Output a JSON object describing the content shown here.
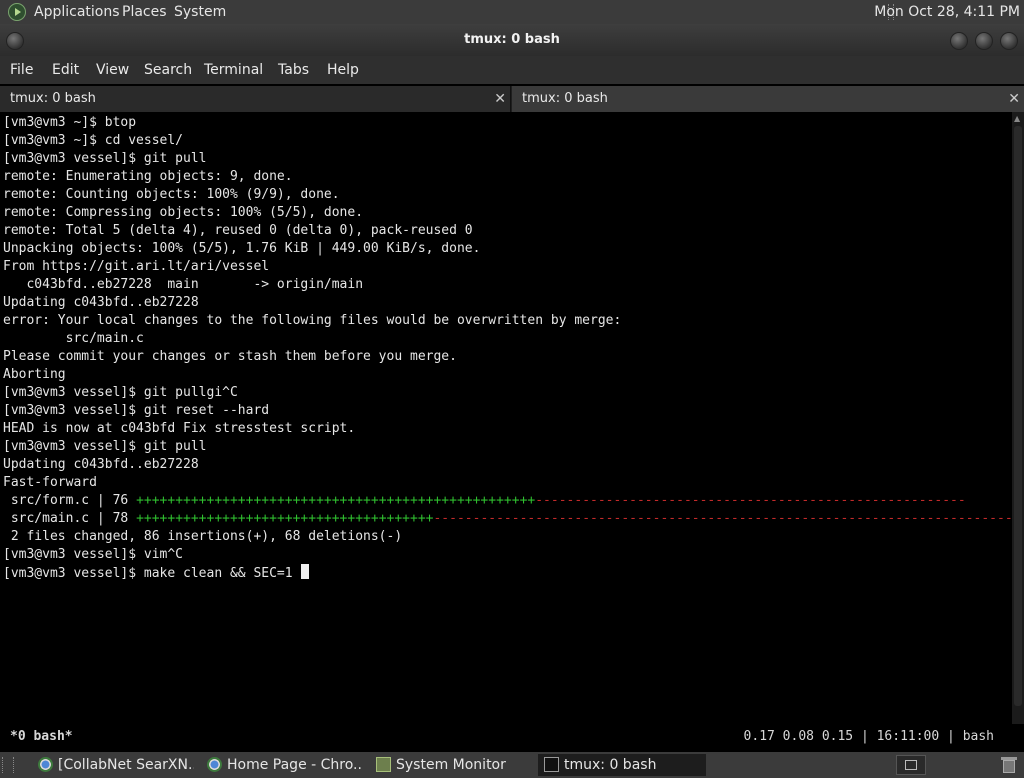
{
  "top_panel": {
    "applications": "Applications",
    "places": "Places",
    "system": "System",
    "clock": "Mon Oct 28,  4:11 PM"
  },
  "window": {
    "title": "tmux: 0 bash"
  },
  "menubar": {
    "file": "File",
    "edit": "Edit",
    "view": "View",
    "search": "Search",
    "terminal": "Terminal",
    "tabs": "Tabs",
    "help": "Help"
  },
  "tabs": [
    {
      "label": "tmux: 0 bash",
      "close": "✕"
    },
    {
      "label": "tmux: 0 bash",
      "close": "✕"
    }
  ],
  "terminal": {
    "lines": [
      "[vm3@vm3 ~]$ btop",
      "[vm3@vm3 ~]$ cd vessel/",
      "[vm3@vm3 vessel]$ git pull",
      "remote: Enumerating objects: 9, done.",
      "remote: Counting objects: 100% (9/9), done.",
      "remote: Compressing objects: 100% (5/5), done.",
      "remote: Total 5 (delta 4), reused 0 (delta 0), pack-reused 0",
      "Unpacking objects: 100% (5/5), 1.76 KiB | 449.00 KiB/s, done.",
      "From https://git.ari.lt/ari/vessel",
      "   c043bfd..eb27228  main       -> origin/main",
      "Updating c043bfd..eb27228",
      "error: Your local changes to the following files would be overwritten by merge:",
      "        src/main.c",
      "Please commit your changes or stash them before you merge.",
      "Aborting",
      "[vm3@vm3 vessel]$ git pullgi^C",
      "[vm3@vm3 vessel]$ git reset --hard",
      "HEAD is now at c043bfd Fix stresstest script.",
      "[vm3@vm3 vessel]$ git pull",
      "Updating c043bfd..eb27228",
      "Fast-forward"
    ],
    "diffstat": [
      {
        "prefix": " src/form.c | 76 ",
        "plus": "+++++++++++++++++++++++++++++++++++++++++++++++++++",
        "minus": "-------------------------------------------------------"
      },
      {
        "prefix": " src/main.c | 78 ",
        "plus": "++++++++++++++++++++++++++++++++++++++",
        "minus": "--------------------------------------------------------------------------------"
      }
    ],
    "after_lines": [
      " 2 files changed, 86 insertions(+), 68 deletions(-)",
      "[vm3@vm3 vessel]$ vim^C"
    ],
    "prompt": "[vm3@vm3 vessel]$ make clean && SEC=1 "
  },
  "tmux_status": {
    "left": "*0 bash*",
    "right": "0.17 0.08 0.15 | 16:11:00 | bash"
  },
  "taskbar": [
    {
      "label": "[CollabNet SearXN...",
      "icon": "chrome-icon"
    },
    {
      "label": "Home Page - Chro...",
      "icon": "chrome-icon"
    },
    {
      "label": "System Monitor",
      "icon": "system-monitor-icon"
    },
    {
      "label": "tmux: 0 bash",
      "icon": "terminal-icon"
    }
  ]
}
